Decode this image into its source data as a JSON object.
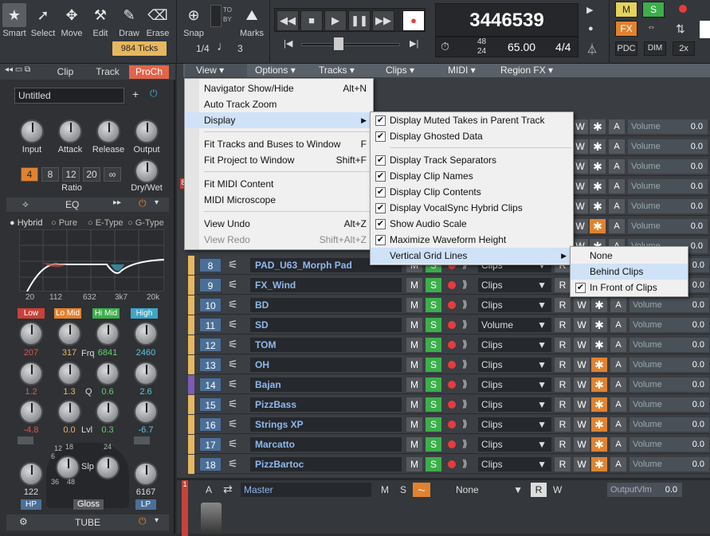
{
  "toolbar": {
    "tools": [
      "Smart",
      "Select",
      "Move",
      "Edit",
      "Draw",
      "Erase"
    ],
    "ticks": "984 Ticks",
    "snap_label": "Snap",
    "snap_value": "1/4",
    "snap_to": "TO",
    "snap_by": "BY",
    "marks_label": "Marks",
    "marks_value": "3",
    "counter": "3446539",
    "time_sig_top": "48",
    "time_sig_bot": "24",
    "tempo": "65.00",
    "meter": "4/4",
    "right_buttons": [
      "M",
      "S",
      "FX",
      "PDC",
      "DIM",
      "2x"
    ]
  },
  "left": {
    "tabs": [
      "Clip",
      "Track",
      "ProCh"
    ],
    "preset_name": "Untitled",
    "comp_knobs": [
      "Input",
      "Attack",
      "Release",
      "Output"
    ],
    "ratio_label": "Ratio",
    "ratio_values": [
      "4",
      "8",
      "12",
      "20",
      "∞"
    ],
    "drywet": "Dry/Wet",
    "eq_label": "EQ",
    "eq_types": [
      "Hybrid",
      "Pure",
      "E-Type",
      "G-Type"
    ],
    "eq_freqs": [
      "20",
      "112",
      "632",
      "3k7",
      "20k"
    ],
    "bands": [
      "Low",
      "Lo Mid",
      "Hi Mid",
      "High"
    ],
    "band_freq": [
      "207",
      "317",
      "6841",
      "2460"
    ],
    "band_gain": [
      "1.2",
      "1.3",
      "0.6",
      "2.6"
    ],
    "band_q": [
      "-4.8",
      "0.0",
      "0.3",
      "-6.7"
    ],
    "frq": "Frq",
    "q": "Q",
    "lvl": "Lvl",
    "slp": "Slp",
    "hp_val": "122",
    "lp_val": "6167",
    "hp": "HP",
    "gloss": "Gloss",
    "lp": "LP",
    "slope_marks": [
      "6",
      "12",
      "18",
      "24",
      "36",
      "48"
    ],
    "tube": "TUBE"
  },
  "menubar": [
    "View",
    "Options",
    "Tracks",
    "Clips",
    "MIDI",
    "Region FX"
  ],
  "view_menu": [
    {
      "label": "Navigator Show/Hide",
      "shortcut": "Alt+N"
    },
    {
      "label": "Auto Track Zoom",
      "shortcut": ""
    },
    {
      "label": "Display",
      "shortcut": ""
    },
    {
      "label": "Fit Tracks and Buses to Window",
      "shortcut": "F"
    },
    {
      "label": "Fit Project to Window",
      "shortcut": "Shift+F"
    },
    {
      "label": "Fit MIDI Content",
      "shortcut": ""
    },
    {
      "label": "MIDI Microscope",
      "shortcut": ""
    },
    {
      "label": "View Undo",
      "shortcut": "Alt+Z"
    },
    {
      "label": "View Redo",
      "shortcut": "Shift+Alt+Z"
    }
  ],
  "display_menu": [
    "Display Muted Takes in Parent Track",
    "Display Ghosted Data",
    "Display Track Separators",
    "Display Clip Names",
    "Display Clip Contents",
    "Display VocalSync Hybrid Clips",
    "Show Audio Scale",
    "Maximize Waveform Height",
    "Vertical Grid Lines"
  ],
  "grid_menu": [
    "None",
    "Behind Clips",
    "In Front of Clips"
  ],
  "tracks": [
    {
      "num": "8",
      "name": "PAD_U63_Morph Pad",
      "mode": "Clips"
    },
    {
      "num": "9",
      "name": "FX_Wind",
      "mode": "Clips"
    },
    {
      "num": "10",
      "name": "BD",
      "mode": "Clips"
    },
    {
      "num": "11",
      "name": "SD",
      "mode": "Volume"
    },
    {
      "num": "12",
      "name": "TOM",
      "mode": "Clips"
    },
    {
      "num": "13",
      "name": "OH",
      "mode": "Clips"
    },
    {
      "num": "14",
      "name": "Bajan",
      "mode": "Clips"
    },
    {
      "num": "15",
      "name": "PizzBass",
      "mode": "Clips"
    },
    {
      "num": "16",
      "name": "Strings XP",
      "mode": "Clips"
    },
    {
      "num": "17",
      "name": "Marcatto",
      "mode": "Clips"
    },
    {
      "num": "18",
      "name": "PizzBartoc",
      "mode": "Clips"
    }
  ],
  "track_buttons": {
    "m": "M",
    "s": "S",
    "r": "R",
    "w": "W"
  },
  "vol_label": "Volume",
  "vol_value": "0.0",
  "master": {
    "num": "1",
    "a": "A",
    "name": "Master",
    "m": "M",
    "s": "S",
    "mode": "None",
    "r": "R",
    "w": "W",
    "out": "OutputVlm",
    "out_val": "0.0"
  }
}
